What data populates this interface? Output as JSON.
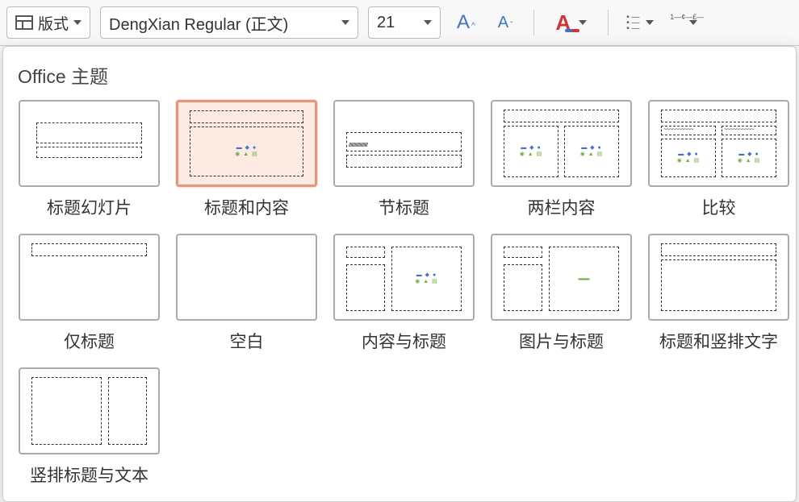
{
  "toolbar": {
    "layout_label": "版式",
    "font_name": "DengXian Regular (正文)",
    "font_size": "21",
    "increase_font": "A",
    "decrease_font": "A",
    "font_color": "A"
  },
  "panel": {
    "title": "Office 主题"
  },
  "layouts": [
    {
      "id": "title-slide",
      "label": "标题幻灯片",
      "selected": false
    },
    {
      "id": "title-content",
      "label": "标题和内容",
      "selected": true
    },
    {
      "id": "section-header",
      "label": "节标题",
      "selected": false
    },
    {
      "id": "two-content",
      "label": "两栏内容",
      "selected": false
    },
    {
      "id": "comparison",
      "label": "比较",
      "selected": false
    },
    {
      "id": "title-only",
      "label": "仅标题",
      "selected": false
    },
    {
      "id": "blank",
      "label": "空白",
      "selected": false
    },
    {
      "id": "content-caption",
      "label": "内容与标题",
      "selected": false
    },
    {
      "id": "picture-caption",
      "label": "图片与标题",
      "selected": false
    },
    {
      "id": "title-vertical-text",
      "label": "标题和竖排文字",
      "selected": false
    },
    {
      "id": "vertical-title-text",
      "label": "竖排标题与文本",
      "selected": false
    }
  ]
}
